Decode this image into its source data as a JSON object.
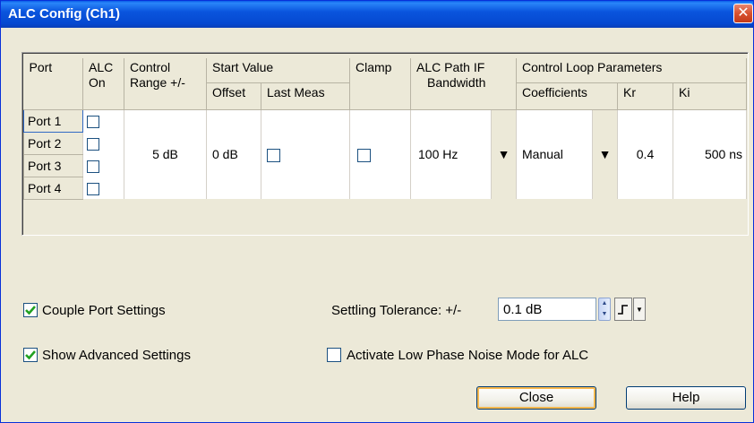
{
  "window": {
    "title": "ALC Config (Ch1)",
    "close_glyph": "✕"
  },
  "table": {
    "headers": {
      "port": "Port",
      "alc_on_1": "ALC",
      "alc_on_2": "On",
      "control_range_1": "Control",
      "control_range_2": "Range +/-",
      "start_value": "Start Value",
      "offset": "Offset",
      "last_meas": "Last Meas",
      "clamp": "Clamp",
      "alc_path_1": "ALC Path IF",
      "alc_path_2": "Bandwidth",
      "control_loop": "Control Loop Parameters",
      "coefficients": "Coefficients",
      "kr": "Kr",
      "ki": "Ki"
    },
    "ports": [
      "Port 1",
      "Port 2",
      "Port 3",
      "Port 4"
    ],
    "control_range": "5 dB",
    "offset": "0 dB",
    "if_bandwidth": "100 Hz",
    "coefficients": "Manual",
    "kr": "0.4",
    "ki": "500 ns",
    "dropdown_glyph": "▼"
  },
  "options": {
    "couple_port_settings": "Couple Port Settings",
    "show_advanced_settings": "Show Advanced Settings",
    "low_phase_noise": "Activate Low Phase Noise Mode for ALC"
  },
  "settling": {
    "label": "Settling Tolerance: +/-",
    "value": "0.1 dB"
  },
  "buttons": {
    "close": "Close",
    "help": "Help"
  }
}
